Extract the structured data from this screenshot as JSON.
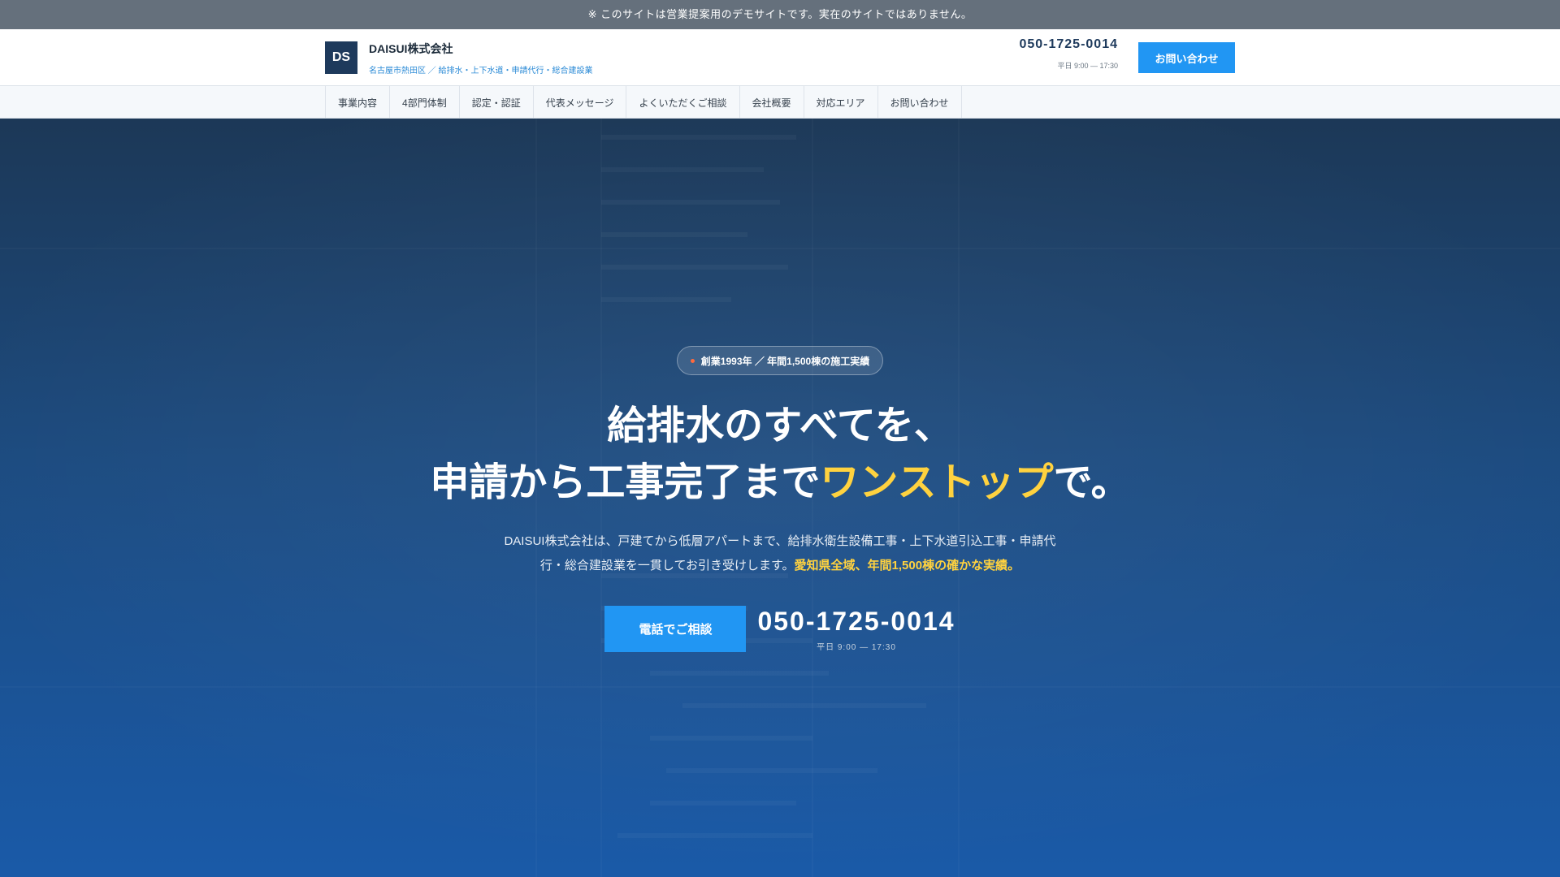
{
  "notice": {
    "text": "※ このサイトは営業提案用のデモサイトです。実在のサイトではありません。"
  },
  "header": {
    "logo_text": "DS",
    "brand_name": "DAISUI株式会社",
    "brand_sub": "名古屋市熱田区 ／ 給排水・上下水道・申請代行・総合建設業",
    "phone": "050-1725-0014",
    "hours": "平日 9:00 — 17:30",
    "contact_button": "お問い合わせ"
  },
  "nav": {
    "items": [
      {
        "label": "事業内容"
      },
      {
        "label": "4部門体制"
      },
      {
        "label": "認定・認証"
      },
      {
        "label": "代表メッセージ"
      },
      {
        "label": "よくいただくご相談"
      },
      {
        "label": "会社概要"
      },
      {
        "label": "対応エリア"
      },
      {
        "label": "お問い合わせ"
      }
    ]
  },
  "hero": {
    "badge": "創業1993年 ／ 年間1,500棟の施工実績",
    "headline_line1": "給排水のすべてを、",
    "headline_line2_pre": "申請から工事完了まで",
    "headline_line2_accent": "ワンストップ",
    "headline_line2_post": "で。",
    "lead_line1": "DAISUI株式会社は、戸建てから低層アパートまで、給排水衛生設備工事・上下水道引込工事・申請代",
    "lead_line2_pre": "行・総合建設業を一貫してお引き受けします。",
    "lead_line2_accent": "愛知県全域、年間1,500棟の確かな実績。",
    "cta_button": "電話でご相談",
    "phone": "050-1725-0014",
    "hours": "平日 9:00 — 17:30"
  },
  "colors": {
    "accent_blue": "#2196f3",
    "accent_yellow": "#ffd23f",
    "navy": "#1e3a5c"
  }
}
